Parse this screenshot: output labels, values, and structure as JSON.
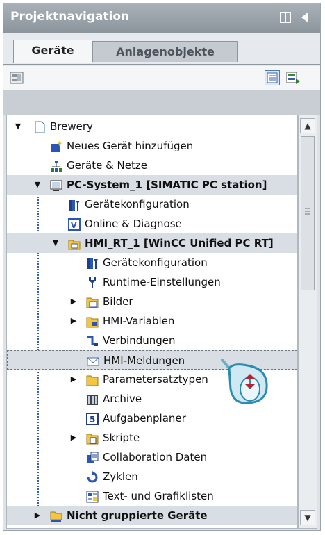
{
  "panel": {
    "title": "Projektnavigation",
    "icons": [
      "pin-icon",
      "collapse-left-icon"
    ],
    "tabs": [
      {
        "label": "Geräte",
        "active": true
      },
      {
        "label": "Anlagenobjekte",
        "active": false
      }
    ]
  },
  "toolbar": {
    "left_icon": "project-view-icon",
    "right_icons": [
      "details-view-icon",
      "tree-view-icon"
    ]
  },
  "tree": {
    "items": [
      {
        "label": "Brewery",
        "icon": "project-icon",
        "expander": "expanded"
      },
      {
        "label": "Neues Gerät hinzufügen",
        "icon": "add-device-icon",
        "expander": "none"
      },
      {
        "label": "Geräte & Netze",
        "icon": "network-icon",
        "expander": "none"
      },
      {
        "label": "PC-System_1 [SIMATIC PC station]",
        "icon": "pc-station-icon",
        "expander": "expanded"
      },
      {
        "label": "Gerätekonfiguration",
        "icon": "device-config-icon",
        "expander": "none"
      },
      {
        "label": "Online & Diagnose",
        "icon": "online-diagnostics-icon",
        "expander": "none"
      },
      {
        "label": "HMI_RT_1 [WinCC Unified PC RT]",
        "icon": "hmi-runtime-icon",
        "expander": "expanded"
      },
      {
        "label": "Gerätekonfiguration",
        "icon": "device-config-icon",
        "expander": "none"
      },
      {
        "label": "Runtime-Einstellungen",
        "icon": "runtime-settings-icon",
        "expander": "none"
      },
      {
        "label": "Bilder",
        "icon": "folder-screens-icon",
        "expander": "collapsed"
      },
      {
        "label": "HMI-Variablen",
        "icon": "folder-tags-icon",
        "expander": "collapsed"
      },
      {
        "label": "Verbindungen",
        "icon": "connections-icon",
        "expander": "none"
      },
      {
        "label": "HMI-Meldungen",
        "icon": "alarms-icon",
        "expander": "none"
      },
      {
        "label": "Parametersatztypen",
        "icon": "folder-icon",
        "expander": "collapsed"
      },
      {
        "label": "Archive",
        "icon": "archive-icon",
        "expander": "none"
      },
      {
        "label": "Aufgabenplaner",
        "icon": "scheduler-icon",
        "expander": "none"
      },
      {
        "label": "Skripte",
        "icon": "scripts-folder-icon",
        "expander": "collapsed"
      },
      {
        "label": "Collaboration Daten",
        "icon": "collaboration-icon",
        "expander": "none"
      },
      {
        "label": "Zyklen",
        "icon": "cycles-icon",
        "expander": "none"
      },
      {
        "label": "Text- und Grafiklisten",
        "icon": "text-graphic-lists-icon",
        "expander": "none"
      },
      {
        "label": "Nicht gruppierte Geräte",
        "icon": "ungrouped-devices-icon",
        "expander": "collapsed"
      }
    ]
  },
  "scrollbar": {
    "up_icon": "scroll-up-icon",
    "down_icon": "scroll-down-icon",
    "grip_icon": "grip-icon"
  },
  "pointer": {
    "icon": "mouse-click-icon"
  }
}
